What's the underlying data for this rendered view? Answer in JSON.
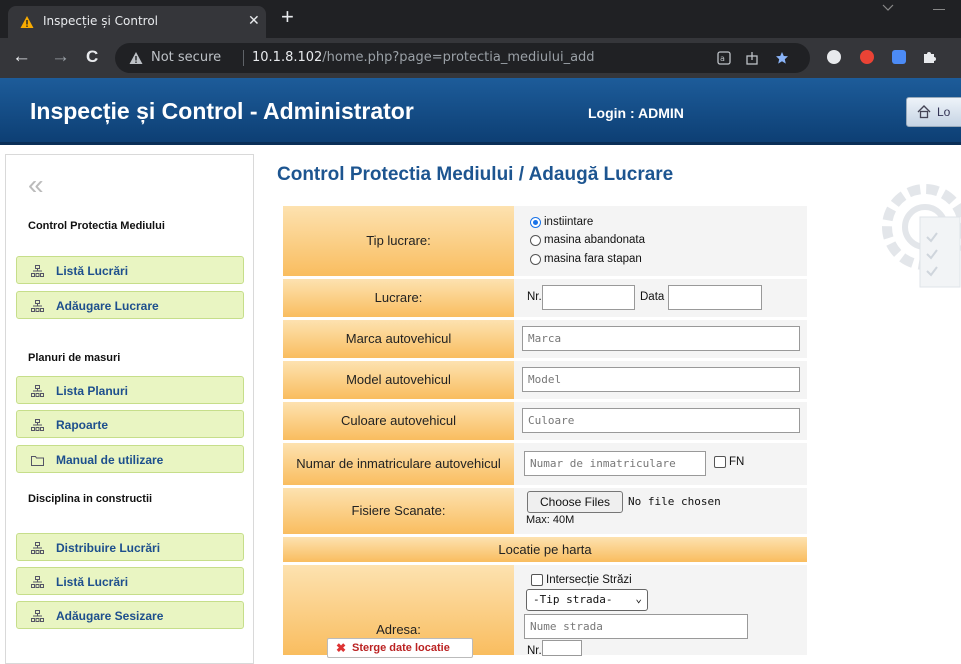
{
  "browser": {
    "tab_title": "Inspecție și Control",
    "tab_close": "✕",
    "new_tab": "+",
    "not_secure": "Not secure",
    "url_host": "10.1.8.102",
    "url_path": "/home.php?page=protectia_mediului_add",
    "nav": {
      "back": "←",
      "forward": "→",
      "reload": "C"
    }
  },
  "header": {
    "title": "Inspecție și Control - Administrator",
    "login": "Login : ADMIN",
    "logout_label": "Lo"
  },
  "sidebar": {
    "collapse": "«",
    "sections": [
      {
        "title": "Control Protectia Mediului"
      },
      {
        "title": "Planuri de masuri"
      },
      {
        "title": "Disciplina in constructii"
      }
    ],
    "items": [
      {
        "label": "Listă Lucrări",
        "icon": "sitemap-icon"
      },
      {
        "label": "Adăugare Lucrare",
        "icon": "sitemap-icon"
      },
      {
        "label": "Lista Planuri",
        "icon": "sitemap-icon"
      },
      {
        "label": "Rapoarte",
        "icon": "sitemap-icon"
      },
      {
        "label": "Manual de utilizare",
        "icon": "folder-icon"
      },
      {
        "label": "Distribuire Lucrări",
        "icon": "sitemap-icon"
      },
      {
        "label": "Listă Lucrări",
        "icon": "sitemap-icon"
      },
      {
        "label": "Adăugare Sesizare",
        "icon": "sitemap-icon"
      }
    ]
  },
  "main": {
    "title": "Control Protectia Mediului / Adaugă Lucrare",
    "form": {
      "tip_lucrare_label": "Tip lucrare:",
      "tip_options": [
        "instiintare",
        "masina abandonata",
        "masina fara stapan"
      ],
      "tip_selected": "instiintare",
      "lucrare_label": "Lucrare:",
      "nr_label": "Nr.",
      "data_label": "Data",
      "nr_value": "",
      "data_value": "",
      "marca_label": "Marca autovehicul",
      "marca_placeholder": "Marca",
      "model_label": "Model autovehicul",
      "model_placeholder": "Model",
      "culoare_label": "Culoare autovehicul",
      "culoare_placeholder": "Culoare",
      "nr_inmat_label": "Numar de inmatriculare autovehicul",
      "nr_inmat_placeholder": "Numar de inmatriculare",
      "fn_label": "FN",
      "fisiere_label": "Fisiere Scanate:",
      "choose_files": "Choose Files",
      "no_file": "No file chosen",
      "max_size": "Max: 40M",
      "locatie_header": "Locatie pe harta",
      "adresa_label": "Adresa:",
      "intersectie_label": "Intersecție Străzi",
      "tip_strada_selected": "-Tip strada-",
      "nume_strada_placeholder": "Nume strada",
      "nr_strada_label": "Nr.",
      "sterge_label": "Sterge date locatie"
    }
  },
  "colors": {
    "header_blue": "#1d5c9a",
    "label_orange": "#f9bd5f",
    "sidebar_green": "#e9f5c2",
    "title_blue": "#1d5590"
  }
}
